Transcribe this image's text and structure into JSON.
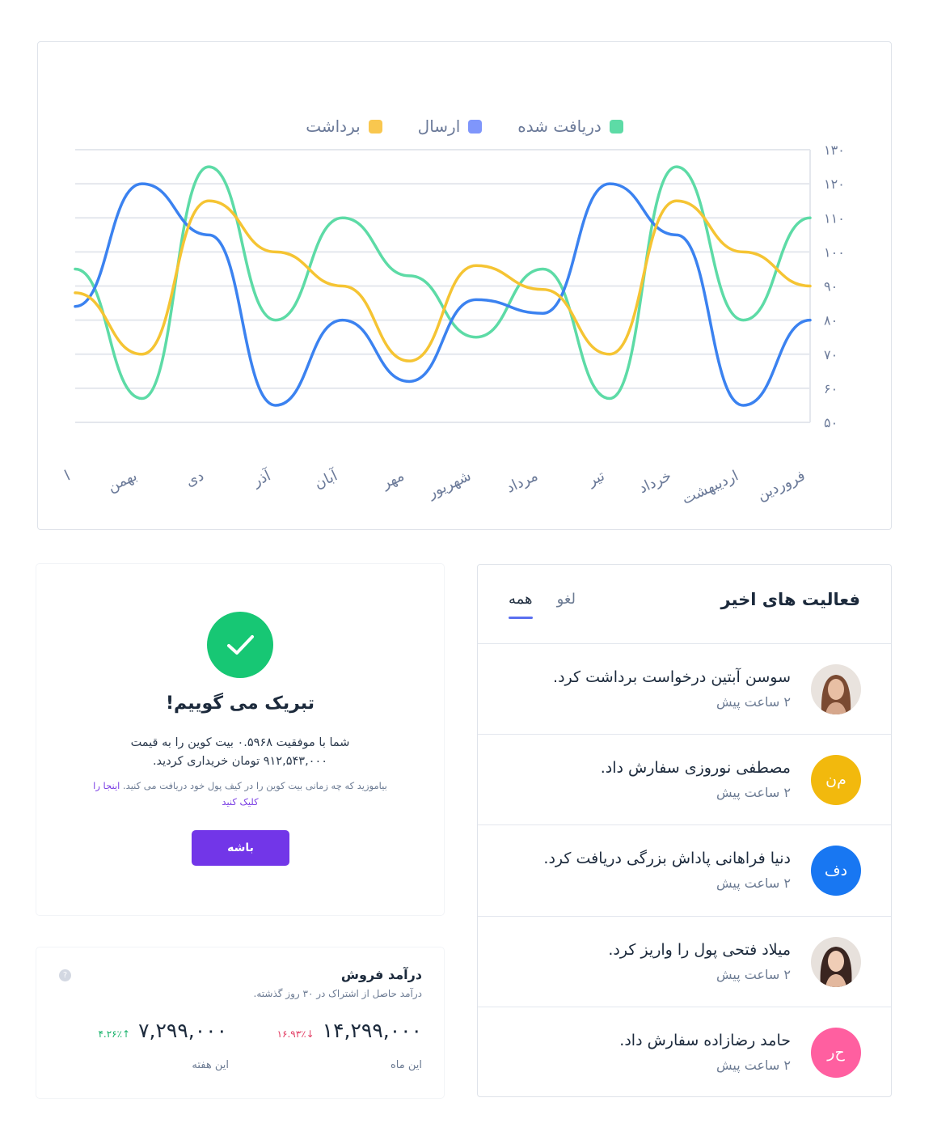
{
  "chart_data": {
    "type": "line",
    "categories": [
      "فروردین",
      "اردیبهشت",
      "خرداد",
      "تیر",
      "مرداد",
      "شهریور",
      "مهر",
      "آبان",
      "آذر",
      "دی",
      "بهمن",
      "ا"
    ],
    "yticks": [
      "۵۰",
      "۶۰",
      "۷۰",
      "۸۰",
      "۹۰",
      "۱۰۰",
      "۱۱۰",
      "۱۲۰",
      "۱۳۰"
    ],
    "ylim": [
      50,
      130
    ],
    "grid": true,
    "legend_position": "top",
    "series": [
      {
        "name": "دریافت شده",
        "color": "#5ddba6",
        "values": [
          110,
          80,
          125,
          57,
          95,
          75,
          93,
          110,
          80,
          125,
          57,
          95
        ]
      },
      {
        "name": "ارسال",
        "color": "#7f96fb",
        "line_color": "#3b82f0",
        "values": [
          80,
          55,
          105,
          120,
          82,
          86,
          62,
          80,
          55,
          105,
          120,
          84
        ]
      },
      {
        "name": "برداشت",
        "color": "#f9c74f",
        "line_color": "#f5c433",
        "values": [
          90,
          100,
          115,
          70,
          89,
          96,
          68,
          90,
          100,
          115,
          70,
          88
        ]
      }
    ]
  },
  "activity": {
    "title": "فعالیت های اخیر",
    "tabs": [
      {
        "label": "همه",
        "active": true
      },
      {
        "label": "لغو",
        "active": false
      }
    ],
    "items": [
      {
        "text": "سوسن آبتین درخواست برداشت کرد.",
        "time": "۲ ساعت پیش",
        "avatar": "",
        "avatar_color": "#c9a48b",
        "photo": true
      },
      {
        "text": "مصطفی نوروزی سفارش داد.",
        "time": "۲ ساعت پیش",
        "avatar": "م‌ن",
        "avatar_color": "#f2b90d",
        "photo": false
      },
      {
        "text": "دنیا فراهانی پاداش بزرگی دریافت کرد.",
        "time": "۲ ساعت پیش",
        "avatar": "دف",
        "avatar_color": "#1877f2",
        "photo": false
      },
      {
        "text": "میلاد فتحی پول را واریز کرد.",
        "time": "۲ ساعت پیش",
        "avatar": "",
        "avatar_color": "#6b4a3a",
        "photo": true
      },
      {
        "text": "حامد رضازاده سفارش داد.",
        "time": "۲ ساعت پیش",
        "avatar": "ح‌ر",
        "avatar_color": "#ff5fa0",
        "photo": false
      }
    ]
  },
  "success": {
    "title": "تبریک می گوییم!",
    "message_line1": "شما با موفقیت ۰.۵۹۶۸ بیت کوین را به قیمت",
    "message_line2": "۹۱۲,۵۴۳,۰۰۰ تومان خریداری کردید.",
    "note": "بیاموزید که چه زمانی بیت کوین را در کیف پول خود دریافت می کنید.",
    "link": "اینجا را کلیک کنید",
    "button": "باشه"
  },
  "revenue": {
    "title": "درآمد فروش",
    "subtitle": "درآمد حاصل از اشتراک در ۳۰ روز گذشته.",
    "help": "?",
    "month": {
      "value": "۱۴,۲۹۹,۰۰۰",
      "change": "↓۱۶.۹۳٪",
      "label": "این ماه"
    },
    "week": {
      "value": "۷,۲۹۹,۰۰۰",
      "change": "↑۴.۲۶٪",
      "label": "این هفته"
    }
  }
}
